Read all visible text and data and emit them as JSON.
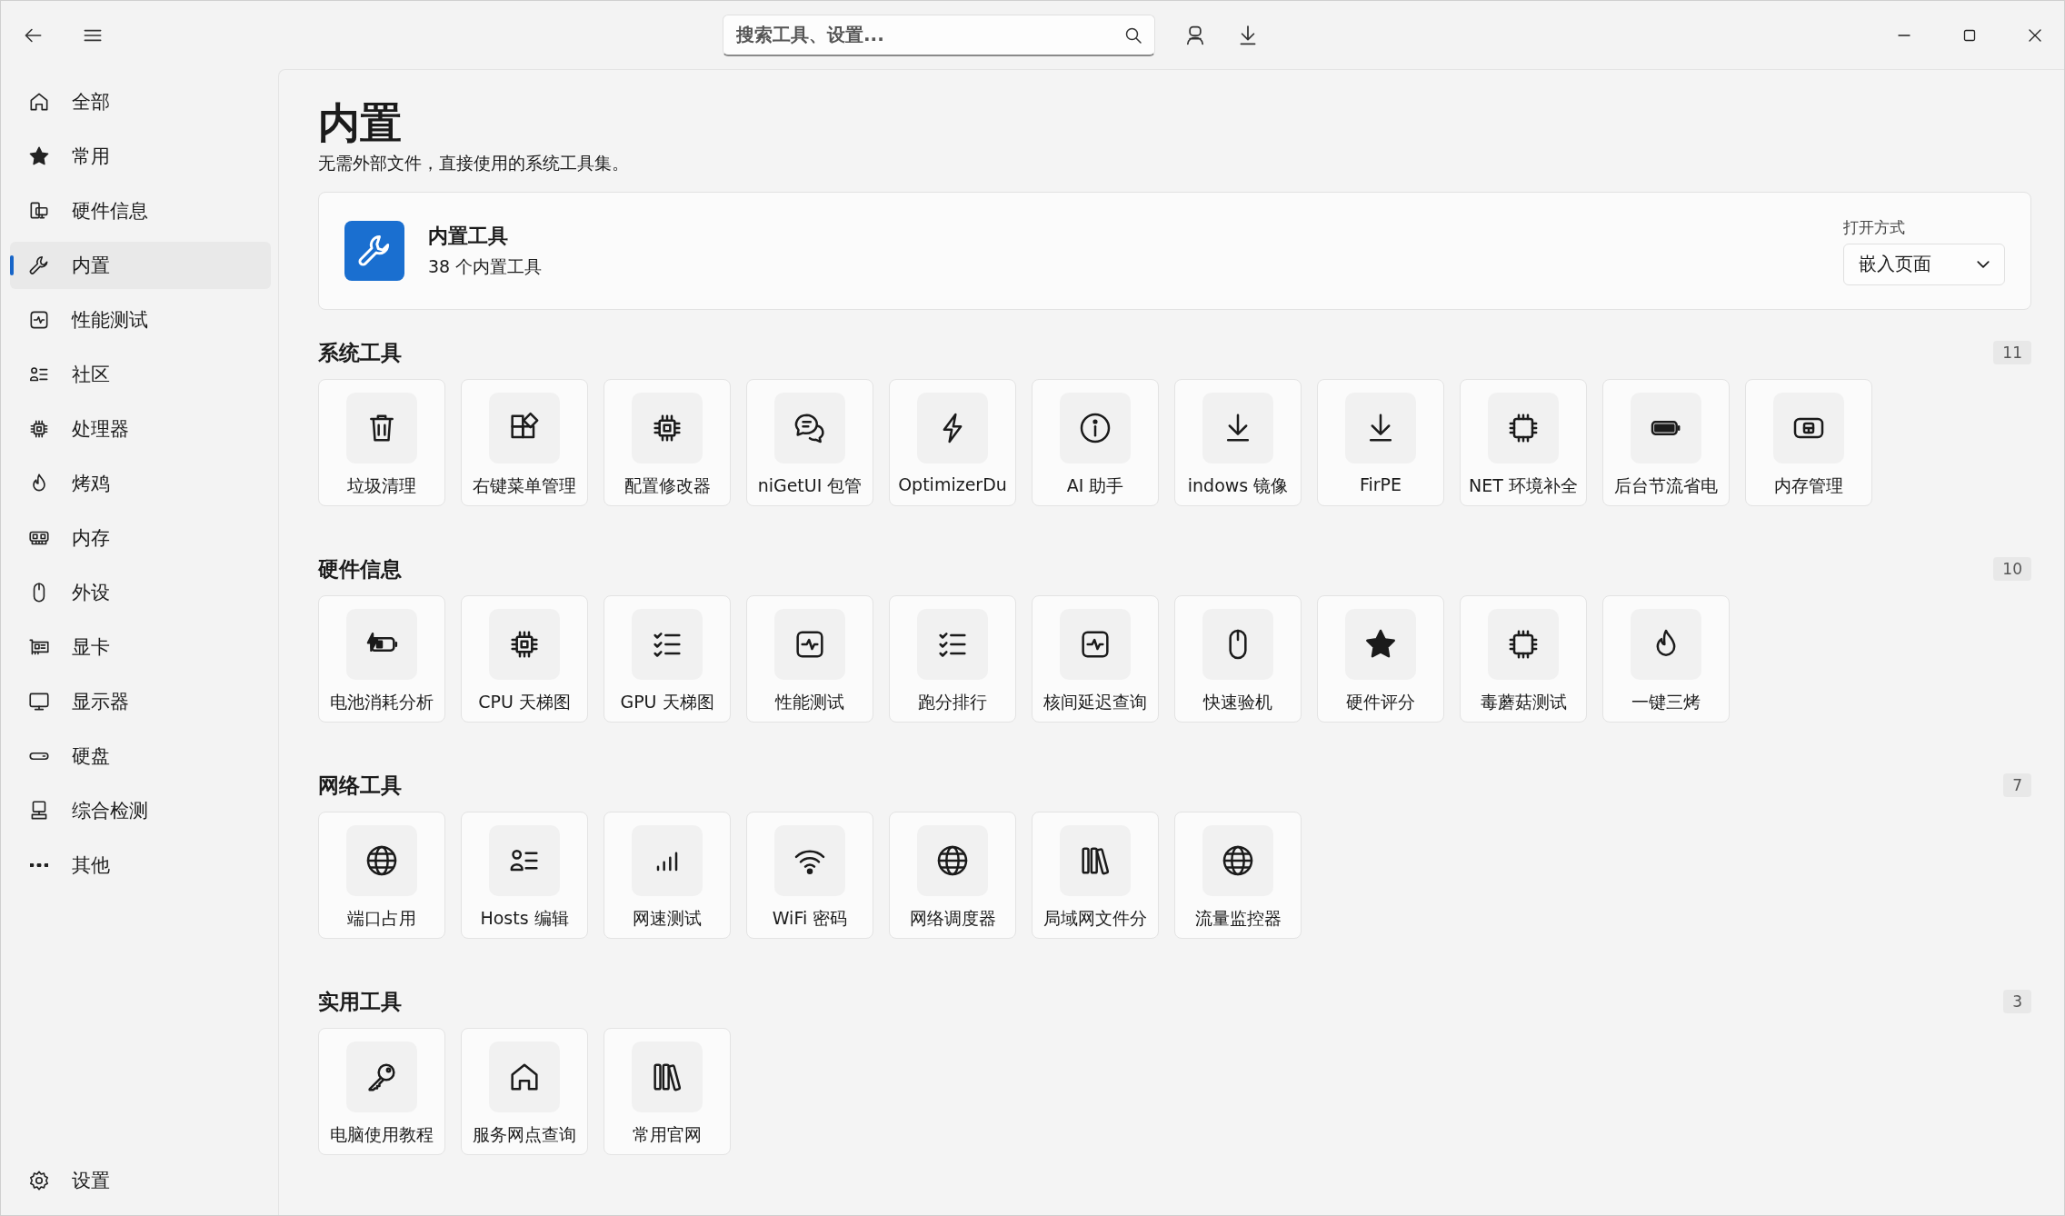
{
  "search": {
    "placeholder": "搜索工具、设置..."
  },
  "sidebar": {
    "items": [
      {
        "label": "全部",
        "kind": "home",
        "selected": false
      },
      {
        "label": "常用",
        "kind": "star",
        "selected": false
      },
      {
        "label": "硬件信息",
        "kind": "devices",
        "selected": false
      },
      {
        "label": "内置",
        "kind": "wrench",
        "selected": true
      },
      {
        "label": "性能测试",
        "kind": "pulse",
        "selected": false
      },
      {
        "label": "社区",
        "kind": "people-list",
        "selected": false
      },
      {
        "label": "处理器",
        "kind": "chip",
        "selected": false
      },
      {
        "label": "烤鸡",
        "kind": "flame",
        "selected": false
      },
      {
        "label": "内存",
        "kind": "memory",
        "selected": false
      },
      {
        "label": "外设",
        "kind": "mouse",
        "selected": false
      },
      {
        "label": "显卡",
        "kind": "graphics-card",
        "selected": false
      },
      {
        "label": "显示器",
        "kind": "monitor",
        "selected": false
      },
      {
        "label": "硬盘",
        "kind": "drive",
        "selected": false
      },
      {
        "label": "综合检测",
        "kind": "computer",
        "selected": false
      },
      {
        "label": "其他",
        "kind": "more",
        "selected": false
      }
    ],
    "footer": {
      "label": "设置",
      "kind": "settings"
    }
  },
  "page": {
    "title": "内置",
    "subtitle": "无需外部文件，直接使用的系统工具集。"
  },
  "header_card": {
    "title": "内置工具",
    "subtitle": "38 个内置工具",
    "open_mode": {
      "label": "打开方式",
      "value": "嵌入页面"
    }
  },
  "sections": [
    {
      "title": "系统工具",
      "count": "11",
      "tools": [
        {
          "label": "垃圾清理",
          "kind": "trash"
        },
        {
          "label": "右键菜单管理",
          "kind": "apps"
        },
        {
          "label": "配置修改器",
          "kind": "chip"
        },
        {
          "label": "niGetUI 包管",
          "kind": "chat"
        },
        {
          "label": "OptimizerDu",
          "kind": "bolt"
        },
        {
          "label": "AI 助手",
          "kind": "info"
        },
        {
          "label": "indows 镜像",
          "kind": "download"
        },
        {
          "label": "FirPE",
          "kind": "download"
        },
        {
          "label": "NET 环境补全",
          "kind": "chip-outline"
        },
        {
          "label": "后台节流省电",
          "kind": "battery"
        },
        {
          "label": "内存管理",
          "kind": "panel"
        }
      ]
    },
    {
      "title": "硬件信息",
      "count": "10",
      "tools": [
        {
          "label": "电池消耗分析",
          "kind": "battery-charge"
        },
        {
          "label": "CPU 天梯图",
          "kind": "chip"
        },
        {
          "label": "GPU 天梯图",
          "kind": "checklist"
        },
        {
          "label": "性能测试",
          "kind": "pulse"
        },
        {
          "label": "跑分排行",
          "kind": "checklist"
        },
        {
          "label": "核间延迟查询",
          "kind": "pulse"
        },
        {
          "label": "快速验机",
          "kind": "mouse"
        },
        {
          "label": "硬件评分",
          "kind": "star"
        },
        {
          "label": "毒蘑菇测试",
          "kind": "chip-outline"
        },
        {
          "label": "一键三烤",
          "kind": "flame"
        }
      ]
    },
    {
      "title": "网络工具",
      "count": "7",
      "tools": [
        {
          "label": "端口占用",
          "kind": "globe"
        },
        {
          "label": "Hosts 编辑",
          "kind": "people-list"
        },
        {
          "label": "网速测试",
          "kind": "signal"
        },
        {
          "label": "WiFi 密码",
          "kind": "wifi"
        },
        {
          "label": "网络调度器",
          "kind": "globe"
        },
        {
          "label": "局域网文件分",
          "kind": "books"
        },
        {
          "label": "流量监控器",
          "kind": "globe"
        }
      ]
    },
    {
      "title": "实用工具",
      "count": "3",
      "tools": [
        {
          "label": "电脑使用教程",
          "kind": "key"
        },
        {
          "label": "服务网点查询",
          "kind": "home"
        },
        {
          "label": "常用官网",
          "kind": "books"
        }
      ]
    }
  ]
}
